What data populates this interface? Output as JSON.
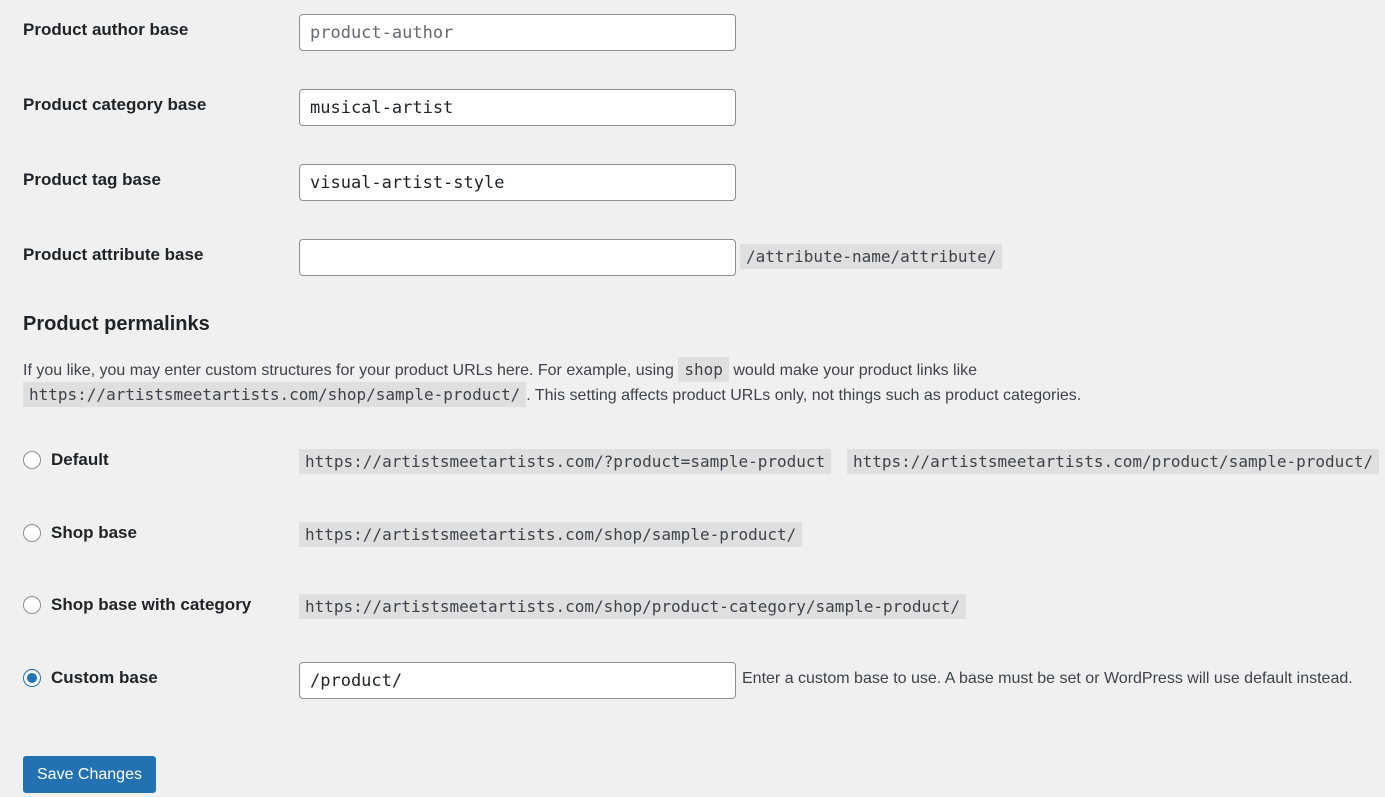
{
  "fields": {
    "author_label": "Product author base",
    "author_placeholder": "product-author",
    "author_value": "",
    "category_label": "Product category base",
    "category_value": "musical-artist",
    "tag_label": "Product tag base",
    "tag_value": "visual-artist-style",
    "attribute_label": "Product attribute base",
    "attribute_value": "",
    "attribute_hint": "/attribute-name/attribute/"
  },
  "permalinks": {
    "heading": "Product permalinks",
    "desc_part1": "If you like, you may enter custom structures for your product URLs here. For example, using",
    "desc_code1": "shop",
    "desc_part2": "would make your product links like",
    "desc_code2": "https://artistsmeetartists.com/shop/sample-product/",
    "desc_part3": ". This setting affects product URLs only, not things such as product categories.",
    "options": [
      {
        "label": "Default",
        "codes": [
          "https://artistsmeetartists.com/?product=sample-product",
          "https://artistsmeetartists.com/product/sample-product/"
        ],
        "checked": false
      },
      {
        "label": "Shop base",
        "codes": [
          "https://artistsmeetartists.com/shop/sample-product/"
        ],
        "checked": false
      },
      {
        "label": "Shop base with category",
        "codes": [
          "https://artistsmeetartists.com/shop/product-category/sample-product/"
        ],
        "checked": false
      },
      {
        "label": "Custom base",
        "value": "/product/",
        "hint": "Enter a custom base to use. A base must be set or WordPress will use default instead.",
        "checked": true
      }
    ]
  },
  "save_label": "Save Changes",
  "accent_color": "#2271b1"
}
